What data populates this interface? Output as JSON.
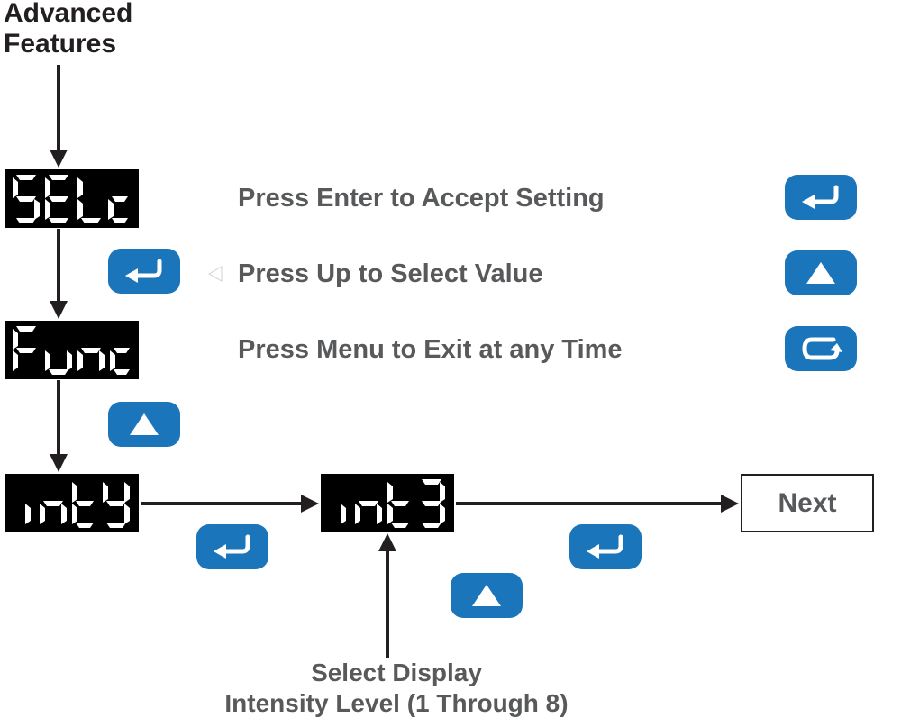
{
  "title": {
    "line1": "Advanced",
    "line2": "Features"
  },
  "lcd": {
    "selc": "SELc",
    "func": "Func",
    "inty": "intY",
    "int3": "int3"
  },
  "instructions": {
    "enter": "Press Enter to Accept Setting",
    "up": "Press Up to Select Value",
    "menu": "Press Menu to Exit at any Time"
  },
  "next_label": "Next",
  "annotation": {
    "line1": "Select Display",
    "line2": "Intensity Level (1 Through 8)"
  },
  "intensity": {
    "min": 1,
    "max": 8,
    "example": 3
  },
  "colors": {
    "button": "#1b75bb",
    "lcd_bg": "#000000",
    "lcd_fg": "#ffffff",
    "text": "#231f20",
    "muted": "#58595b"
  }
}
